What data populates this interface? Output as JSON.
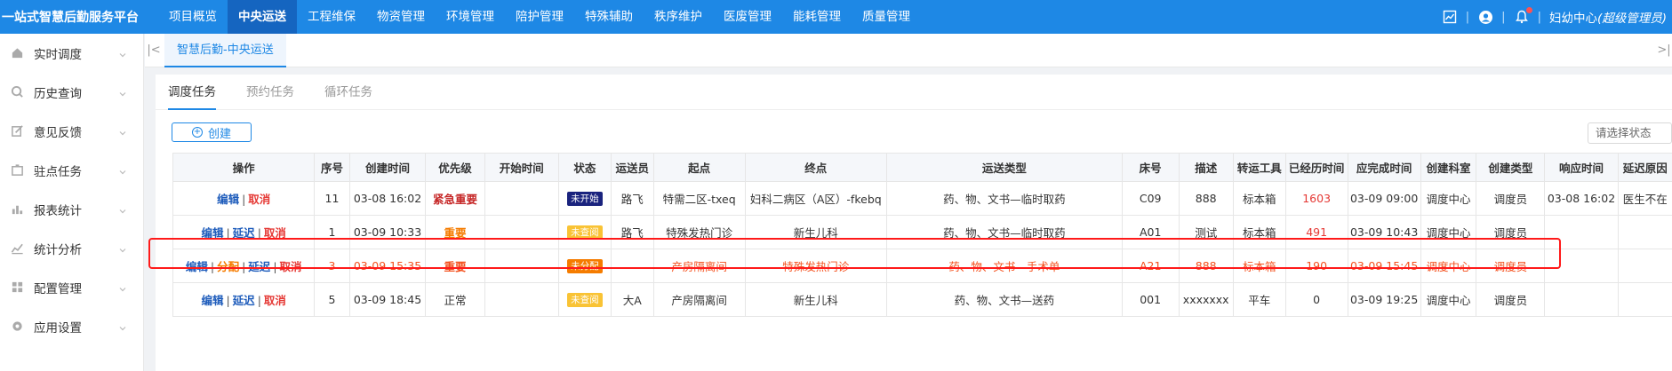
{
  "brand": "一站式智慧后勤服务平台",
  "nav": [
    "项目概览",
    "中央运送",
    "工程维保",
    "物资管理",
    "环境管理",
    "陪护管理",
    "特殊辅助",
    "秩序维护",
    "医废管理",
    "能耗管理",
    "质量管理"
  ],
  "user": {
    "name": "妇幼中心",
    "role": "(超级管理员)"
  },
  "sidebar": [
    {
      "label": "实时调度",
      "icon": "home-icon"
    },
    {
      "label": "历史查询",
      "icon": "search-icon"
    },
    {
      "label": "意见反馈",
      "icon": "edit-icon"
    },
    {
      "label": "驻点任务",
      "icon": "station-icon"
    },
    {
      "label": "报表统计",
      "icon": "bar-chart-icon"
    },
    {
      "label": "统计分析",
      "icon": "analysis-icon"
    },
    {
      "label": "配置管理",
      "icon": "grid-icon"
    },
    {
      "label": "应用设置",
      "icon": "gear-icon"
    }
  ],
  "page_tab": "智慧后勤-中央运送",
  "subtabs": [
    "调度任务",
    "预约任务",
    "循环任务"
  ],
  "toolbar": {
    "create": "创建",
    "status_placeholder": "请选择状态"
  },
  "table": {
    "headers": [
      "操作",
      "序号",
      "创建时间",
      "优先级",
      "开始时间",
      "状态",
      "运送员",
      "起点",
      "终点",
      "运送类型",
      "床号",
      "描述",
      "转运工具",
      "已经历时间",
      "应完成时间",
      "创建科室",
      "创建类型",
      "响应时间",
      "延迟原因"
    ],
    "rows": [
      {
        "actions": [
          "编辑",
          "取消"
        ],
        "no": "11",
        "created": "03-08 16:02",
        "priority": "紧急重要",
        "start": "",
        "status": "未开始",
        "status_color": "#1a237e",
        "porter": "路飞",
        "from": "特需二区-txeq",
        "to": "妇科二病区（A区）-fkebq",
        "type": "药、物、文书—临时取药",
        "bed": "C09",
        "desc": "888",
        "tool": "标本箱",
        "elapsed": "1603",
        "due": "03-09 09:00",
        "dept": "调度中心",
        "ctype": "调度员",
        "resp": "03-08 16:02",
        "delay": "医生不在"
      },
      {
        "actions": [
          "编辑",
          "延迟",
          "取消"
        ],
        "no": "1",
        "created": "03-09 10:33",
        "priority": "重要",
        "start": "",
        "status": "未查阅",
        "status_color": "#f9c335",
        "porter": "路飞",
        "from": "特殊发热门诊",
        "to": "新生儿科",
        "type": "药、物、文书—临时取药",
        "bed": "A01",
        "desc": "测试",
        "tool": "标本箱",
        "elapsed": "491",
        "due": "03-09 10:43",
        "dept": "调度中心",
        "ctype": "调度员",
        "resp": "",
        "delay": ""
      },
      {
        "actions": [
          "编辑",
          "分配",
          "延迟",
          "取消"
        ],
        "no": "3",
        "created": "03-09 15:35",
        "priority": "重要",
        "start": "",
        "status": "未分配",
        "status_color": "#f57c00",
        "porter": "",
        "from": "产房隔离间",
        "to": "特殊发热门诊",
        "type": "药、物、文书—手术单",
        "bed": "A21",
        "desc": "888",
        "tool": "标本箱",
        "elapsed": "190",
        "due": "03-09 15:45",
        "dept": "调度中心",
        "ctype": "调度员",
        "resp": "",
        "delay": ""
      },
      {
        "actions": [
          "编辑",
          "延迟",
          "取消"
        ],
        "no": "5",
        "created": "03-09 18:45",
        "priority": "正常",
        "start": "",
        "status": "未查阅",
        "status_color": "#f9c335",
        "porter": "大A",
        "from": "产房隔离间",
        "to": "新生儿科",
        "type": "药、物、文书—送药",
        "bed": "001",
        "desc": "xxxxxxx",
        "tool": "平车",
        "elapsed": "0",
        "due": "03-09 19:25",
        "dept": "调度中心",
        "ctype": "调度员",
        "resp": "",
        "delay": ""
      }
    ]
  },
  "colors": {
    "primary": "#1e88e5",
    "highlight": "#ff1a1a",
    "danger": "#e53935"
  }
}
